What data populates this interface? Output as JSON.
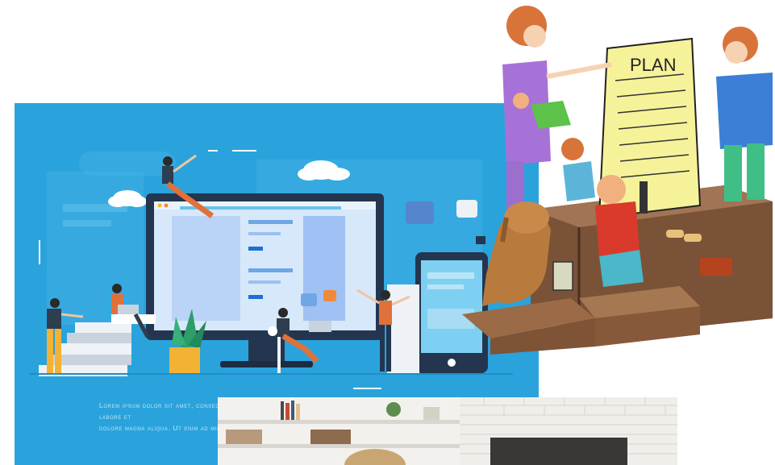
{
  "illustration_left": {
    "caption_line1": "Lorem ipsum dolor sit amet, consectetur adipiscing elit, sed do eiusmod tempor incididunt ut labore et",
    "caption_line2": "dolore magna aliqua. Ut enim ad minim veniam",
    "background_color": "#2aa3dc"
  },
  "illustration_right": {
    "sign_text": "PLAN"
  },
  "photo_bottom": {}
}
